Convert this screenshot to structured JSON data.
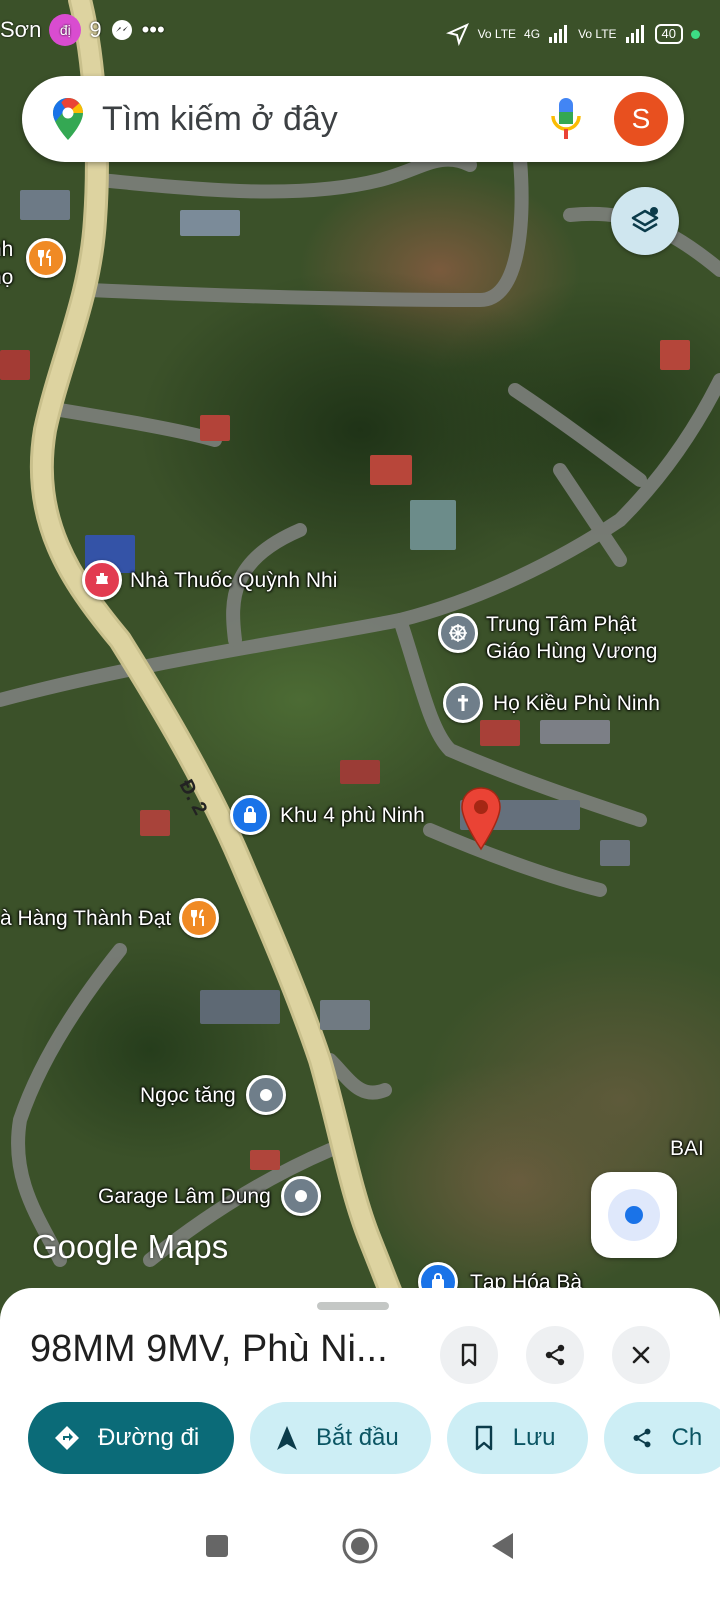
{
  "status_bar": {
    "partial_label": "Sơn",
    "time": "9",
    "app_badge": "đị",
    "battery": "40",
    "network_labels": [
      "Vo LTE",
      "4G",
      "Vo LTE"
    ]
  },
  "search": {
    "placeholder": "Tìm kiếm ở đây",
    "profile_initial": "S"
  },
  "map": {
    "road_label": "Đ. 2",
    "watermark": "Google Maps",
    "pois": [
      {
        "label": "",
        "extra": "nh\nhọ",
        "type": "restaurant"
      },
      {
        "label": "Nhà Thuốc Quỳnh Nhi",
        "type": "pharmacy"
      },
      {
        "label": "Trung Tâm Phật\nGiáo Hùng Vương",
        "type": "buddhist"
      },
      {
        "label": "Họ Kiều Phù Ninh",
        "type": "church"
      },
      {
        "label": "Khu 4 phù Ninh",
        "type": "shopping"
      },
      {
        "label": "à Hàng Thành Đạt",
        "type": "restaurant"
      },
      {
        "label": "Ngọc tăng",
        "type": "place"
      },
      {
        "label": "Garage Lâm Dung",
        "type": "place"
      },
      {
        "label": "Tạp Hóa Bà",
        "type": "shopping"
      },
      {
        "label": "BAI",
        "type": "text"
      }
    ]
  },
  "sheet": {
    "title": "98MM 9MV, Phù Ni...",
    "actions": [
      {
        "label": "Đường đi",
        "icon": "directions-icon"
      },
      {
        "label": "Bắt đầu",
        "icon": "navigation-icon"
      },
      {
        "label": "Lưu",
        "icon": "bookmark-icon"
      },
      {
        "label": "Ch",
        "icon": "share-icon"
      }
    ]
  },
  "colors": {
    "primary_chip": "#0b6b78",
    "secondary_chip": "#cdeef5",
    "pin": "#ea4335",
    "locate": "#1a73e8"
  }
}
